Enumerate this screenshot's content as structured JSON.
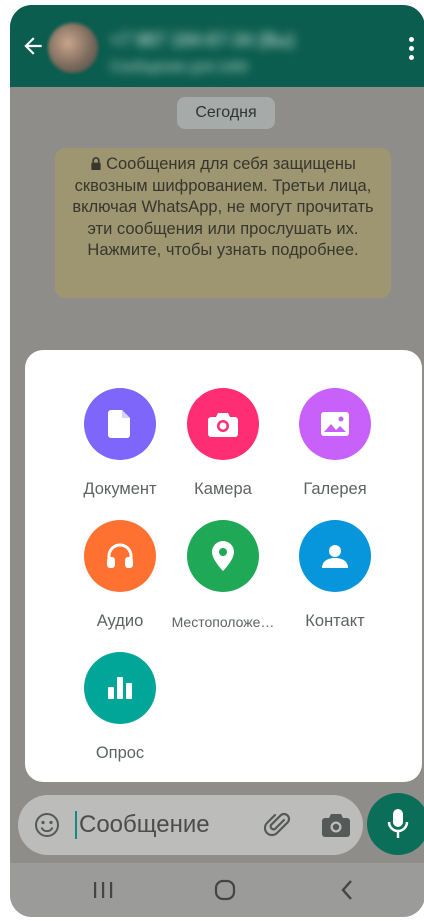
{
  "header": {
    "contact_name": "+7 987 184-67-34 (Вы)",
    "contact_status": "Сообщение для себя"
  },
  "chat": {
    "date_label": "Сегодня",
    "encryption_notice": "Сообщения для себя защищены сквозным шифрованием. Третьи лица, включая WhatsApp, не могут прочитать эти сообщения или прослушать их. Нажмите, чтобы узнать подробнее."
  },
  "attach_menu": {
    "items": [
      {
        "label": "Документ",
        "icon": "document-icon",
        "color": "#7e66fb"
      },
      {
        "label": "Камера",
        "icon": "camera-icon",
        "color": "#ff2e74"
      },
      {
        "label": "Галерея",
        "icon": "gallery-icon",
        "color": "#c861fa"
      },
      {
        "label": "Аудио",
        "icon": "headphones-icon",
        "color": "#ff7130"
      },
      {
        "label": "Местоположе…",
        "icon": "location-icon",
        "color": "#1fa855"
      },
      {
        "label": "Контакт",
        "icon": "contact-icon",
        "color": "#0795dc"
      },
      {
        "label": "Опрос",
        "icon": "poll-icon",
        "color": "#02a698"
      }
    ]
  },
  "composer": {
    "placeholder": "Сообщение"
  },
  "colors": {
    "header": "#0b5d4f",
    "accent": "#0a6e59"
  }
}
